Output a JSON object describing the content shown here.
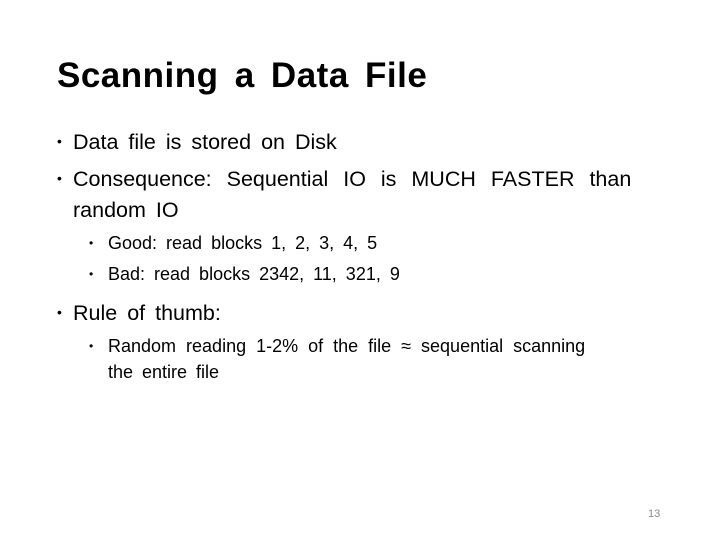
{
  "slide": {
    "title": "Scanning a Data File",
    "bullets": [
      {
        "text": "Data file is stored on Disk"
      },
      {
        "text_line1": "Consequence: Sequential IO is MUCH FASTER than",
        "text_line2": "random IO",
        "sub_bullets": [
          {
            "text": "Good: read blocks 1, 2, 3, 4, 5"
          },
          {
            "text": "Bad: read blocks 2342, 11, 321, 9"
          }
        ]
      },
      {
        "text": "Rule of thumb:",
        "sub_bullets": [
          {
            "text_line1": "Random reading 1-2% of the file ≈ sequential scanning",
            "text_line2": "the entire file"
          }
        ]
      }
    ],
    "bullet_glyph": "•",
    "page_number": "13"
  }
}
